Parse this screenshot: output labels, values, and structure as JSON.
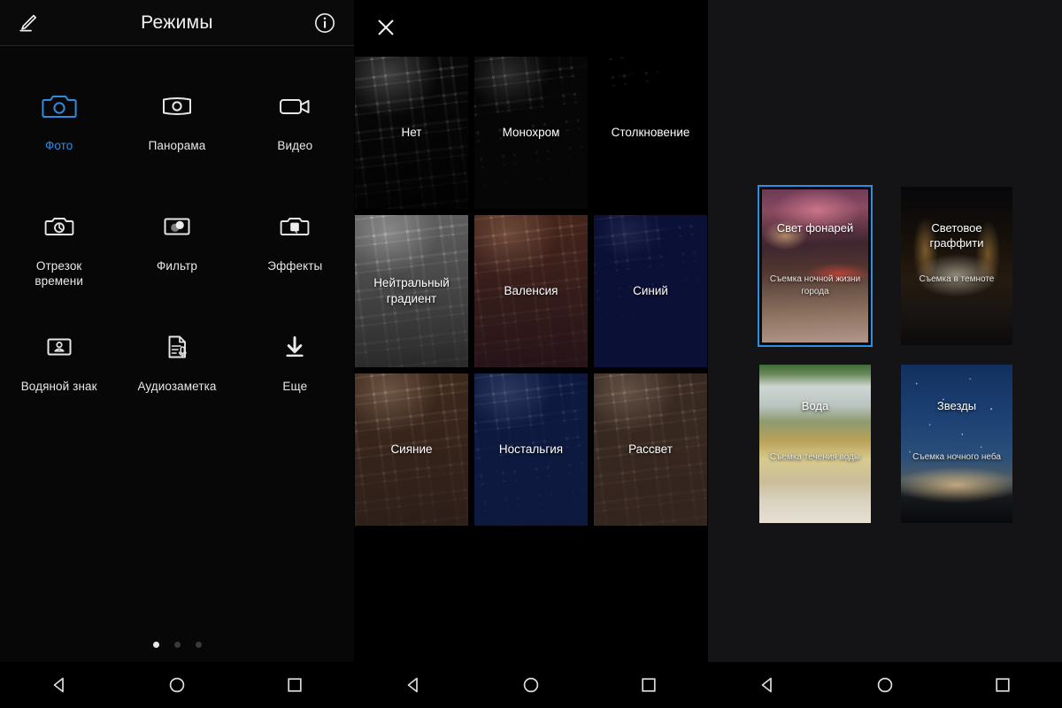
{
  "colors": {
    "accent_blue": "#2d8ee4",
    "label_blue": "#2e8ce0",
    "panel_bg_modes": "#070708",
    "panel_bg_filters": "#000000",
    "panel_bg_scenes": "#141417",
    "text_primary": "#f2f2f2"
  },
  "modes_panel": {
    "header": {
      "title": "Режимы",
      "left_icon": "edit-pencil-icon",
      "right_icon": "info-circle-icon"
    },
    "items": [
      {
        "label": "Фото",
        "icon": "camera-icon",
        "selected": true
      },
      {
        "label": "Панорама",
        "icon": "panorama-icon",
        "selected": false
      },
      {
        "label": "Видео",
        "icon": "video-camera-icon",
        "selected": false
      },
      {
        "label": "Отрезок времени",
        "icon": "time-lapse-icon",
        "selected": false
      },
      {
        "label": "Фильтр",
        "icon": "filter-circles-icon",
        "selected": false
      },
      {
        "label": "Эффекты",
        "icon": "effects-camera-icon",
        "selected": false
      },
      {
        "label": "Водяной знак",
        "icon": "watermark-stamp-icon",
        "selected": false
      },
      {
        "label": "Аудиозаметка",
        "icon": "audio-note-icon",
        "selected": false
      },
      {
        "label": "Еще",
        "icon": "download-arrow-icon",
        "selected": false
      }
    ],
    "pager": {
      "total": 3,
      "active_index": 0
    },
    "navbar": {
      "back": "back-triangle-icon",
      "home": "home-circle-icon",
      "recents": "recents-square-icon"
    }
  },
  "filters_panel": {
    "header": {
      "close_icon": "close-x-icon"
    },
    "tiles": [
      {
        "name": "Нет",
        "selected": false,
        "tint": "rgba(0,0,0,0)"
      },
      {
        "name": "Монохром",
        "selected": false,
        "tint": "rgba(20,20,20,0.30)"
      },
      {
        "name": "Столкновение",
        "selected": false,
        "tint": "rgba(0,0,0,0.52)"
      },
      {
        "name": "Нейтральный градиент",
        "selected": false,
        "tint": "rgba(205,205,205,0.22)"
      },
      {
        "name": "Валенсия",
        "selected": true,
        "tint": "rgba(120,60,45,0.40)"
      },
      {
        "name": "Синий",
        "selected": false,
        "tint": "rgba(25,35,120,0.45)"
      },
      {
        "name": "Сияние",
        "selected": false,
        "tint": "rgba(150,95,65,0.38)"
      },
      {
        "name": "Ностальгия",
        "selected": false,
        "tint": "rgba(30,60,150,0.42)"
      },
      {
        "name": "Рассвет",
        "selected": false,
        "tint": "rgba(150,105,85,0.34)"
      }
    ],
    "navbar": {
      "back": "back-triangle-icon",
      "home": "home-circle-icon",
      "recents": "recents-square-icon"
    }
  },
  "scenes_panel": {
    "cards": [
      {
        "title": "Свет фонарей",
        "subtitle": "Съемка ночной жизни города",
        "selected": true,
        "bg": "bg-city"
      },
      {
        "title": "Световое граффити",
        "subtitle": "Съемка в темноте",
        "selected": false,
        "bg": "bg-graffiti"
      },
      {
        "title": "Вода",
        "subtitle": "Съемка течения воды",
        "selected": false,
        "bg": "bg-water"
      },
      {
        "title": "Звезды",
        "subtitle": "Съемка ночного неба",
        "selected": false,
        "bg": "bg-stars"
      }
    ],
    "navbar": {
      "back": "back-triangle-icon",
      "home": "home-circle-icon",
      "recents": "recents-square-icon"
    }
  }
}
